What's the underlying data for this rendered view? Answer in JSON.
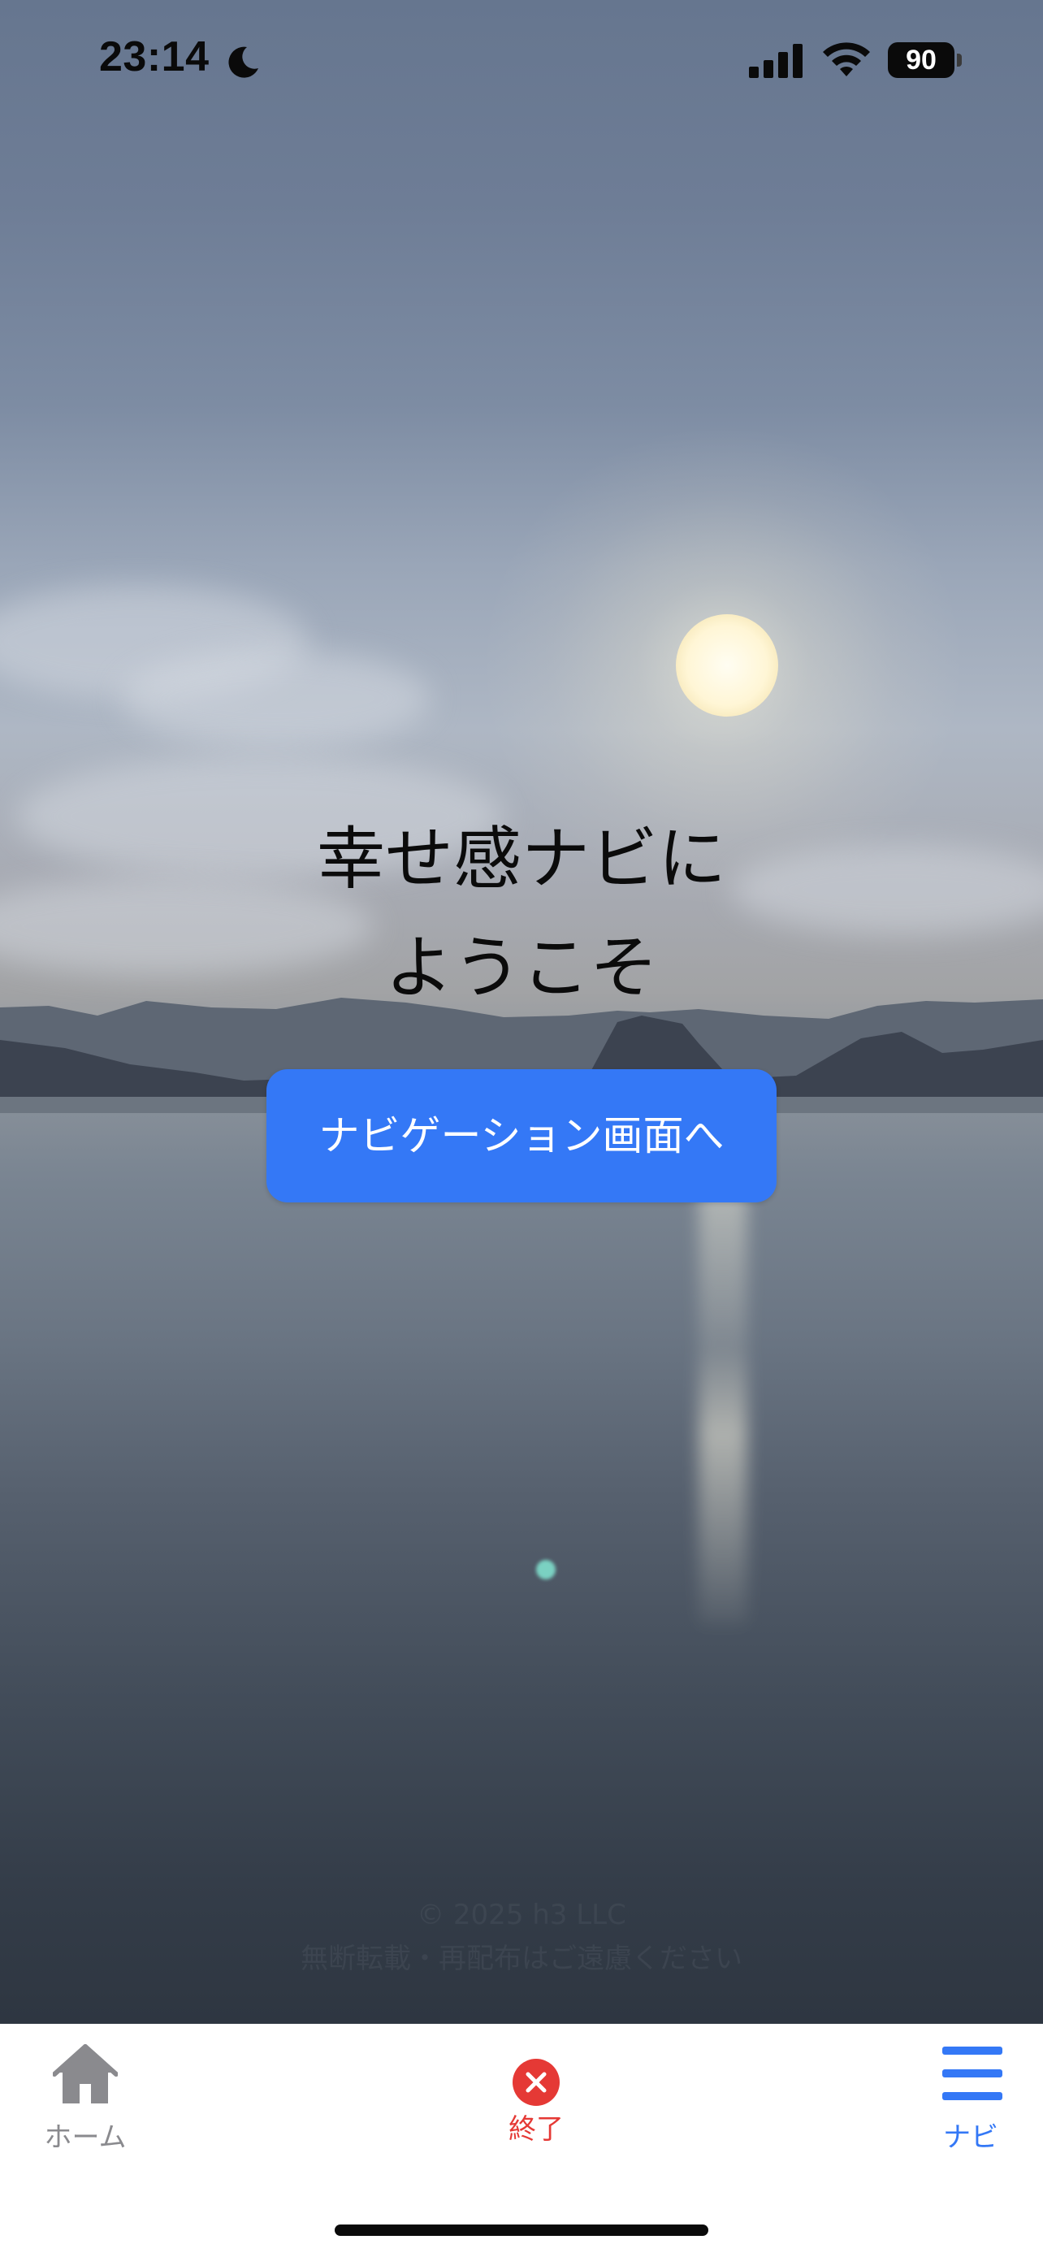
{
  "status_bar": {
    "time": "23:14",
    "battery": "90"
  },
  "welcome": {
    "line1": "幸せ感ナビに",
    "line2": "ようこそ"
  },
  "cta_button": {
    "label": "ナビゲーション画面へ"
  },
  "footer": {
    "copyright": "© 2025 h3 LLC",
    "notice": "無断転載・再配布はご遠慮ください"
  },
  "tab_bar": {
    "items": [
      {
        "label": "ホーム",
        "icon": "home-icon",
        "color": "#8a8a8e"
      },
      {
        "label": "終了",
        "icon": "close-circle-icon",
        "color": "#e53935"
      },
      {
        "label": "ナビ",
        "icon": "menu-icon",
        "color": "#3478f6"
      }
    ]
  },
  "colors": {
    "accent": "#3478f6",
    "danger": "#e53935",
    "inactive": "#8a8a8e"
  }
}
